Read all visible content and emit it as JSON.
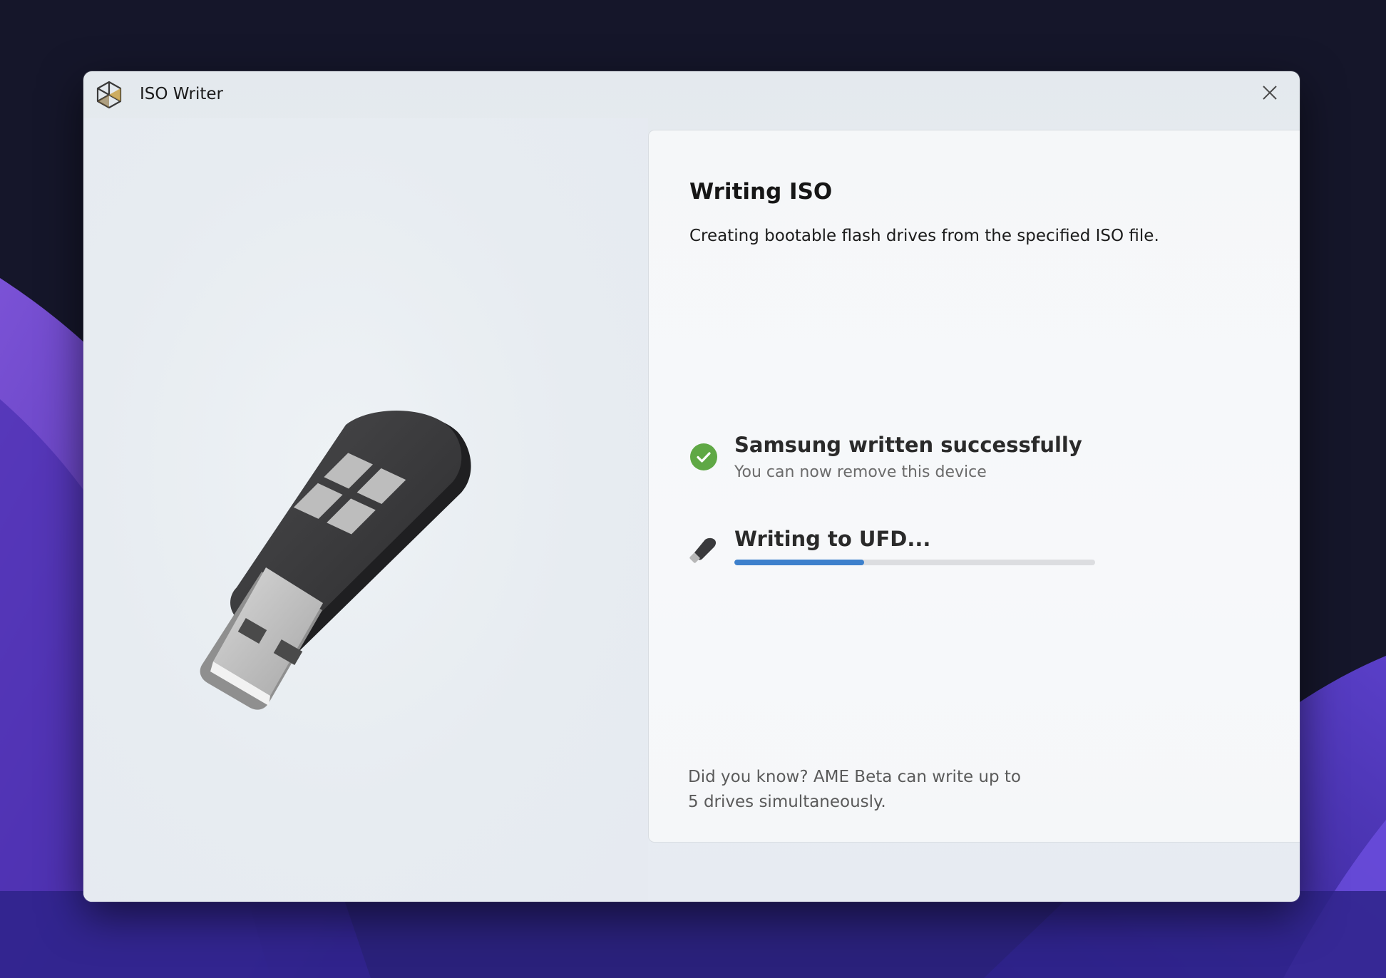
{
  "window": {
    "title": "ISO Writer",
    "app_icon": "iso-writer-logo-icon",
    "close_icon": "close-icon"
  },
  "hero": {
    "image": "windows-usb-flash-drive-illustration"
  },
  "card": {
    "title": "Writing ISO",
    "subtitle": "Creating bootable flash drives from the specified ISO file."
  },
  "status": {
    "success": {
      "icon": "check-circle-icon",
      "title": "Samsung written successfully",
      "subtitle": "You can now remove this device"
    },
    "writing": {
      "icon": "usb-drive-icon",
      "title": "Writing to UFD...",
      "progress": 0.36
    }
  },
  "tip": {
    "line1": "Did you know? AME Beta can write up to",
    "line2": "5 drives simultaneously."
  },
  "colors": {
    "accent": "#3d80cc",
    "success": "#5fa845",
    "text_primary": "#161616",
    "text_secondary": "#6b6b6b"
  }
}
